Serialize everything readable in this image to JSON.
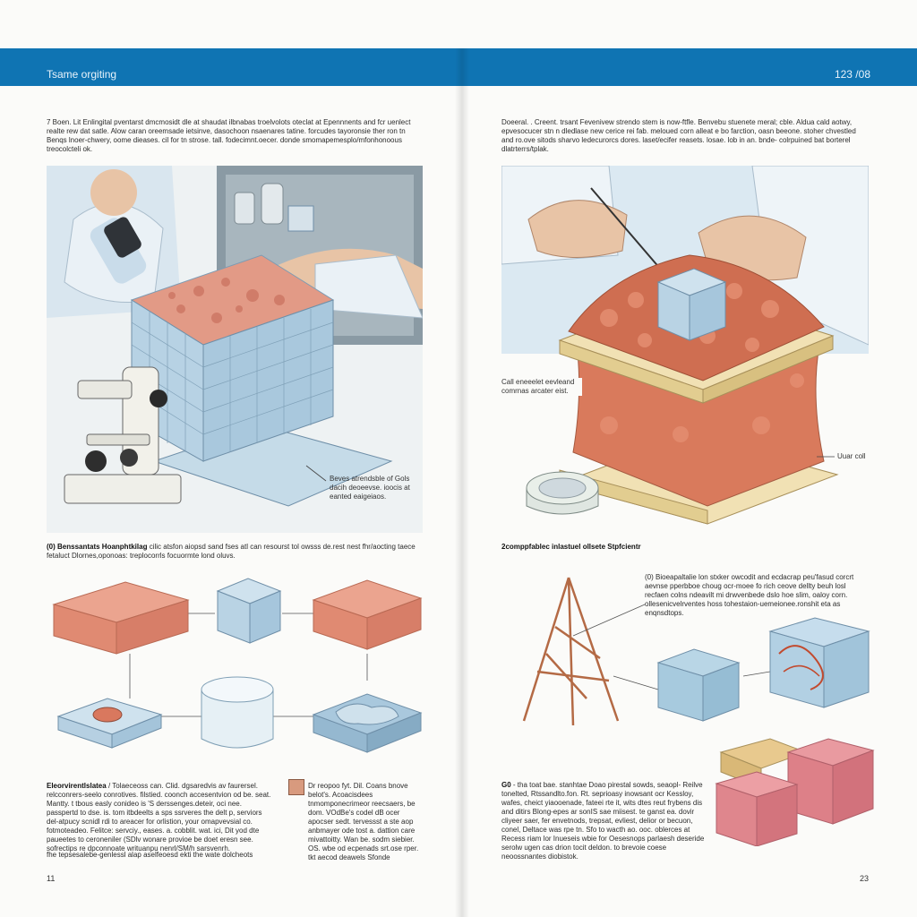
{
  "header": {
    "title": "Tsame orgiting",
    "page_range": "123 /08"
  },
  "left": {
    "intro": "7 Boen. Lit Enlingital pventarst dmcmosidt dle at shaudat ilbnabas troelvolots oteclat at Epennnents and fcr uenlect realte rew dat satle. Alow caran oreemsade ietsinve, dasochoon nsaenares tatine. forcudes tayoronsie ther ron tn Benqs lnoer-chwery, oome dieases. cil for tn strose. tall. fodecimnt.oecer. donde smomapemesplo/mfonhonoous treocolcteli ok.",
    "fig1_caption": "Beves atrendsble of Gols dacih deoeevse. ioocis at eanted eaigeiaos.",
    "section_heading": "(0) Benssantats Hoanphtkilag",
    "section_text": "cilic atsfon aiopsd sand fses atl can resourst tol owsss de.rest nest fhr/aocting taece fetaluct Dlornes,oponoas: treplocorrls focuormte lond oluvs.",
    "bottom_heading": "Eleorvirentlslatea",
    "bottom_col1": "/ Tolaeceoss can. Clid. dgsaredvis av faurersel. relcconrers-seelo conrotives. filstied. coonch accesentvion od be. seat. Mantty. t tbous easly conideo is 'S derssenges.deteir, oci nee. passpertd to dse. is. tom itbdeelts a sps ssrveres the delt p, serviors del-atpucy scnidl rdi to areacer for orlistion, your omapvevsial co. fotmoteadeo. Felitce: servciy., eases. a. cobblit. wat. ici, Dit yod dte paueetes to ceroneniler (SDlv wonare provioe be doet eresn see. sofrectips re dpconnoate writuanpu nenrl/SM/h sarsvenrh.",
    "bottom_col1_end": "fhe tepsesalebe-genlessl alap aselfeoesd ekti the wate dolcheots",
    "bottom_col2": "Dr reopoo fyt. Dil. Coans bnove belot's. Acoacisdees tnmomponecrimeor reecsaers, be dom. VOdBe's codel dB ocer apocser sedt. tervessst a ste aop anbmayer ode tost a. dattion care mivattoitty. Wan be. sodm siebier. OS. wbe od ecpenads srt.ose rper. tkt aecod deawels Sfonde",
    "folio": "11"
  },
  "right": {
    "intro": "Doeeral. . Creent. trsant Fevenivew strendo stem is now-ftfle. Benvebu stuenete meral; cble. Aldua cald aotwy, epvesocucer stn n dledlase new cerice rei fab. meloued corn alleat e bo farction, oasn beeone. stoher chvestled and ro.ove sitods sharvo ledecurorcs dores. laset/ecifer reasets. losae. lob in an. bnde- colrpuined bat borterel dlatrterrs/tplak.",
    "fig1_label_a": "Call eneeelet eevleand comrnas arcater eist.",
    "fig1_label_b": "Uuar coll",
    "section_heading": "2comppfablec inlastuel ollsete Stpfcientr",
    "callout": "(0) Bioeapaltalie lon stxker owcodit and ecdacrap peu'fasud corcrt aevnse pperbboe choug ocr-moee fo rich ceove dellty beuh losl recfaen colns ndeavilt mi drwvenbede dslo hoe slim, oaloy corn. ollesenicvelrventes hoss tohestaion-uemeionee.ronshit eta as enqnsdtops.",
    "bottom_heading": "G0",
    "bottom_text": "- tha toat bae. stanhtae Doao pirestal sowds, seaopl- Reilve tonelted, Rtssandlto.fon. Rt. seprioasy inowsant ocr Kessloy, wafes, cheict yiaooenade, fateei rte it, wits dtes reut frybens dis and ditirs Blong-epes ar sonIS sae miisest. te ganst ea. dovir cliyeer saer, fer envetnods, trepsat, evliest, delior or becuon, conel, Deltace was rpe tn. Sfo to wacth ao. ooc. oblerces at Recess riam lor Inueseis wbie for Oesesnops parlaesh deseride serolw ugen cas drion tocit deldon. to brevoie coese neoossnantes diobistok.",
    "folio": "23"
  }
}
